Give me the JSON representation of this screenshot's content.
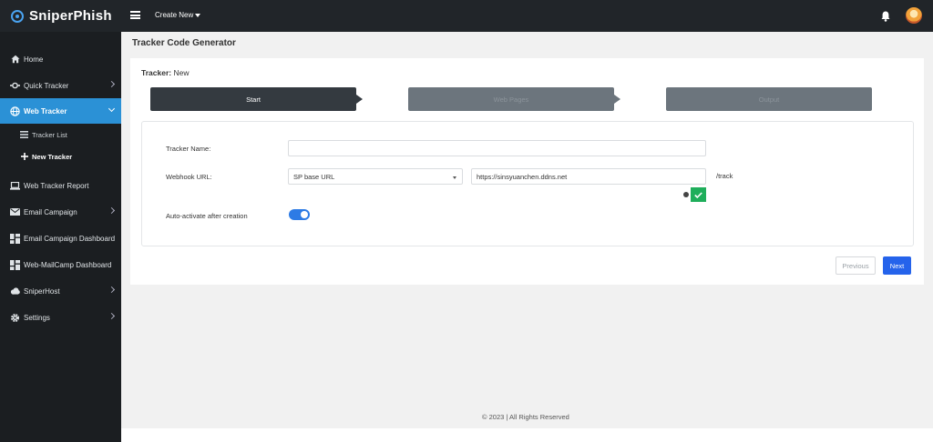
{
  "app": {
    "name": "SniperPhish"
  },
  "topbar": {
    "create_new": "Create New"
  },
  "sidebar": {
    "items": [
      {
        "label": "Home",
        "icon": "home-icon"
      },
      {
        "label": "Quick Tracker",
        "icon": "crosshair-icon"
      },
      {
        "label": "Web Tracker",
        "icon": "globe-icon"
      },
      {
        "label": "Web Tracker Report",
        "icon": "laptop-icon"
      },
      {
        "label": "Email Campaign",
        "icon": "envelope-icon"
      },
      {
        "label": "Email Campaign Dashboard",
        "icon": "dashboard-icon"
      },
      {
        "label": "Web-MailCamp Dashboard",
        "icon": "dashboard-icon"
      },
      {
        "label": "SniperHost",
        "icon": "cloud-icon"
      },
      {
        "label": "Settings",
        "icon": "gear-icon"
      }
    ],
    "web_tracker_sub": [
      {
        "label": "Tracker List",
        "icon": "list-icon"
      },
      {
        "label": "New Tracker",
        "icon": "plus-icon"
      }
    ]
  },
  "page": {
    "title": "Tracker Code Generator",
    "tracker_prefix": "Tracker:",
    "tracker_value": "New"
  },
  "steps": [
    {
      "label": "Start"
    },
    {
      "label": "Web Pages"
    },
    {
      "label": "Output"
    }
  ],
  "form": {
    "tracker_name_label": "Tracker Name:",
    "tracker_name_value": "",
    "webhook_label": "Webhook URL:",
    "webhook_select": "SP base URL",
    "webhook_url": "https://sinsyuanchen.ddns.net",
    "webhook_suffix": "/track",
    "auto_activate_label": "Auto-activate after creation",
    "auto_activate": true
  },
  "buttons": {
    "previous": "Previous",
    "next": "Next"
  },
  "footer": {
    "text": "© 2023 | All Rights Reserved"
  },
  "colors": {
    "accent": "#2b91d6",
    "primary_button": "#2563eb",
    "success": "#1fae5b"
  }
}
